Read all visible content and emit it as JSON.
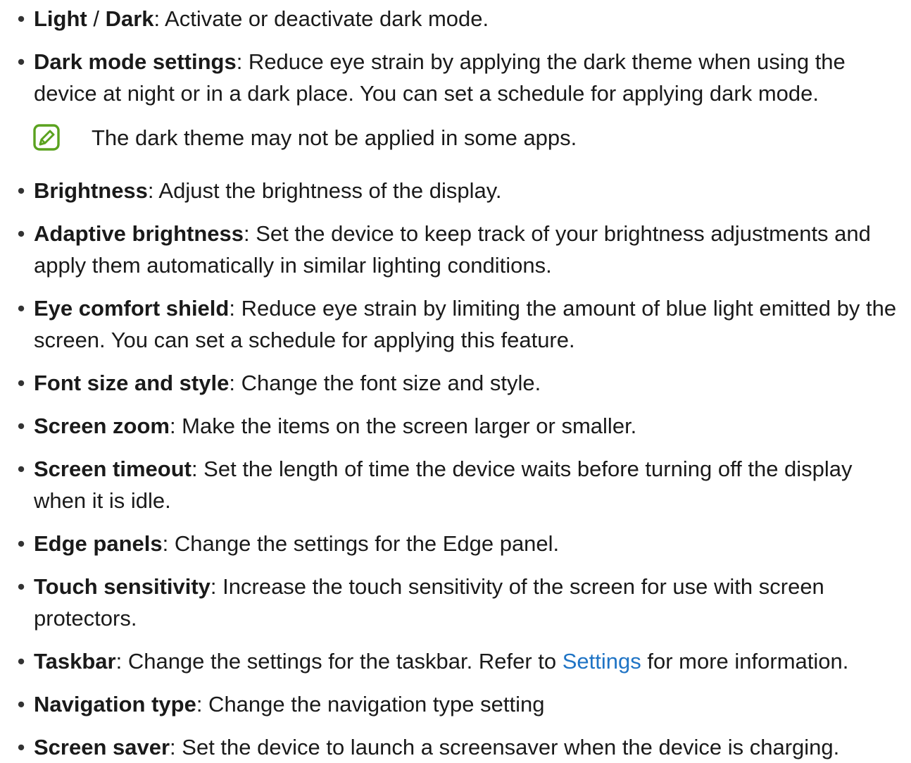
{
  "items": [
    {
      "term": "Light",
      "sep": " / ",
      "term2": "Dark",
      "desc": ": Activate or deactivate dark mode."
    },
    {
      "term": "Dark mode settings",
      "desc": ": Reduce eye strain by applying the dark theme when using the device at night or in a dark place. You can set a schedule for applying dark mode."
    },
    {
      "term": "Brightness",
      "desc": ": Adjust the brightness of the display."
    },
    {
      "term": "Adaptive brightness",
      "desc": ": Set the device to keep track of your brightness adjustments and apply them automatically in similar lighting conditions."
    },
    {
      "term": "Eye comfort shield",
      "desc": ": Reduce eye strain by limiting the amount of blue light emitted by the screen. You can set a schedule for applying this feature."
    },
    {
      "term": "Font size and style",
      "desc": ": Change the font size and style."
    },
    {
      "term": "Screen zoom",
      "desc": ": Make the items on the screen larger or smaller."
    },
    {
      "term": "Screen timeout",
      "desc": ": Set the length of time the device waits before turning off the display when it is idle."
    },
    {
      "term": "Edge panels",
      "desc": ": Change the settings for the Edge panel."
    },
    {
      "term": "Touch sensitivity",
      "desc": ": Increase the touch sensitivity of the screen for use with screen protectors."
    },
    {
      "term": "Taskbar",
      "desc_before": ": Change the settings for the taskbar. Refer to ",
      "link": "Settings",
      "desc_after": " for more information."
    },
    {
      "term": "Navigation type",
      "desc": ": Change the navigation type setting"
    },
    {
      "term": "Screen saver",
      "desc": ": Set the device to launch a screensaver when the device is charging."
    }
  ],
  "note": {
    "icon": "note-pencil-icon",
    "text": "The dark theme may not be applied in some apps."
  },
  "bullet_char": "•",
  "colors": {
    "link": "#1f74c5",
    "note_icon": "#5aa21f"
  }
}
